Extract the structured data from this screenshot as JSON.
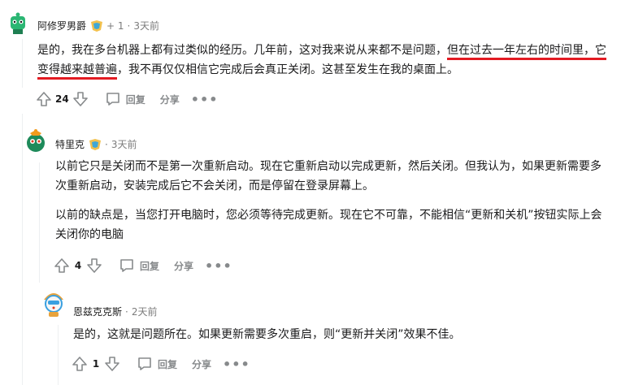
{
  "comments": [
    {
      "author": "阿修罗男爵",
      "karma": "+ 1",
      "time": "3天前",
      "text_a": "是的，我在多台机器上都有过类似的经历。几年前，这对我来说从来都不是问题，",
      "text_b": "但在过去一年左右的",
      "text_c": "时间里，它变得越来越普遍",
      "text_d": "，我不再仅仅相信它完成后会真正关闭。这甚至发生在我的桌面上。",
      "score": "24",
      "reply": "回复",
      "share": "分享",
      "more": "•••"
    },
    {
      "author": "特里克",
      "time": "3天前",
      "para1": "以前它只是关闭而不是第一次重新启动。现在它重新启动以完成更新，然后关闭。但我认为，如果更新需要多次重新启动，安装完成后它不会关闭，而是停留在登录屏幕上。",
      "para2": "以前的缺点是，当您打开电脑时，您必须等待完成更新。现在它不可靠，不能相信“更新和关机”按钮实际上会关闭你的电脑",
      "score": "4",
      "reply": "回复",
      "share": "分享",
      "more": "•••"
    },
    {
      "author": "恩兹克克斯",
      "time": "2天前",
      "text": "是的，这就是问题所在。如果更新需要多次重启，则“更新并关闭”效果不佳。",
      "score": "1",
      "reply": "回复",
      "share": "分享",
      "more": "•••"
    }
  ],
  "icons": [
    "upvote-icon",
    "downvote-icon",
    "reply-icon",
    "more-icon"
  ],
  "colors": {
    "underline": "#e31b23",
    "meta": "#7c7c7c",
    "action": "#878a8c"
  }
}
